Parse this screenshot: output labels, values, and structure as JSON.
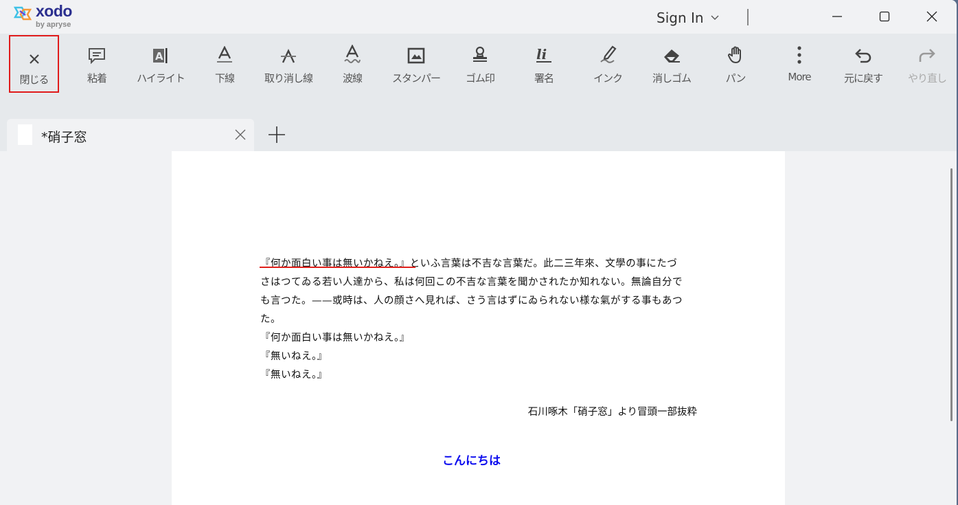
{
  "app": {
    "logo_text": "xodo",
    "logo_sub": "by apryse",
    "sign_in": "Sign In"
  },
  "toolbar": {
    "tools": [
      {
        "key": "close",
        "label": "閉じる",
        "icon": "close-icon"
      },
      {
        "key": "sticky",
        "label": "粘着",
        "icon": "comment-icon"
      },
      {
        "key": "highlight",
        "label": "ハイライト",
        "icon": "highlight-icon"
      },
      {
        "key": "underline",
        "label": "下線",
        "icon": "underline-icon"
      },
      {
        "key": "strikeout",
        "label": "取り消し線",
        "icon": "strikeout-icon"
      },
      {
        "key": "squiggly",
        "label": "波線",
        "icon": "squiggly-icon"
      },
      {
        "key": "stamper",
        "label": "スタンパー",
        "icon": "image-icon"
      },
      {
        "key": "rubber-stamp",
        "label": "ゴム印",
        "icon": "stamp-icon"
      },
      {
        "key": "signature",
        "label": "署名",
        "icon": "signature-icon"
      },
      {
        "key": "ink",
        "label": "インク",
        "icon": "pen-icon"
      },
      {
        "key": "eraser",
        "label": "消しゴム",
        "icon": "eraser-icon"
      },
      {
        "key": "pan",
        "label": "パン",
        "icon": "hand-icon"
      },
      {
        "key": "more",
        "label": "More",
        "icon": "more-vertical-icon"
      },
      {
        "key": "undo",
        "label": "元に戻す",
        "icon": "undo-icon"
      },
      {
        "key": "redo",
        "label": "やり直し",
        "icon": "redo-icon",
        "disabled": true
      }
    ]
  },
  "tabs": {
    "active_title": "*硝子窓"
  },
  "document": {
    "lines": [
      "『何か面白い事は無いかねえ。』といふ言葉は不吉な言葉だ。此二三年來、文學の事にたづ",
      "さはつてゐる若い人達から、私は何回この不吉な言葉を聞かされたか知れない。無論自分で",
      "も言つた。——或時は、人の顔さへ見れば、さう言はずにゐられない様な氣がする事もあつ",
      "た。",
      "『何か面白い事は無いかねえ。』",
      "『無いねえ。』",
      "『無いねえ。』"
    ],
    "credit": "石川啄木「硝子窓」より冒頭一部抜粋",
    "annotation_text": "こんにちは",
    "annotation_color": "#0b0bee",
    "underline_color": "#e0201b"
  }
}
